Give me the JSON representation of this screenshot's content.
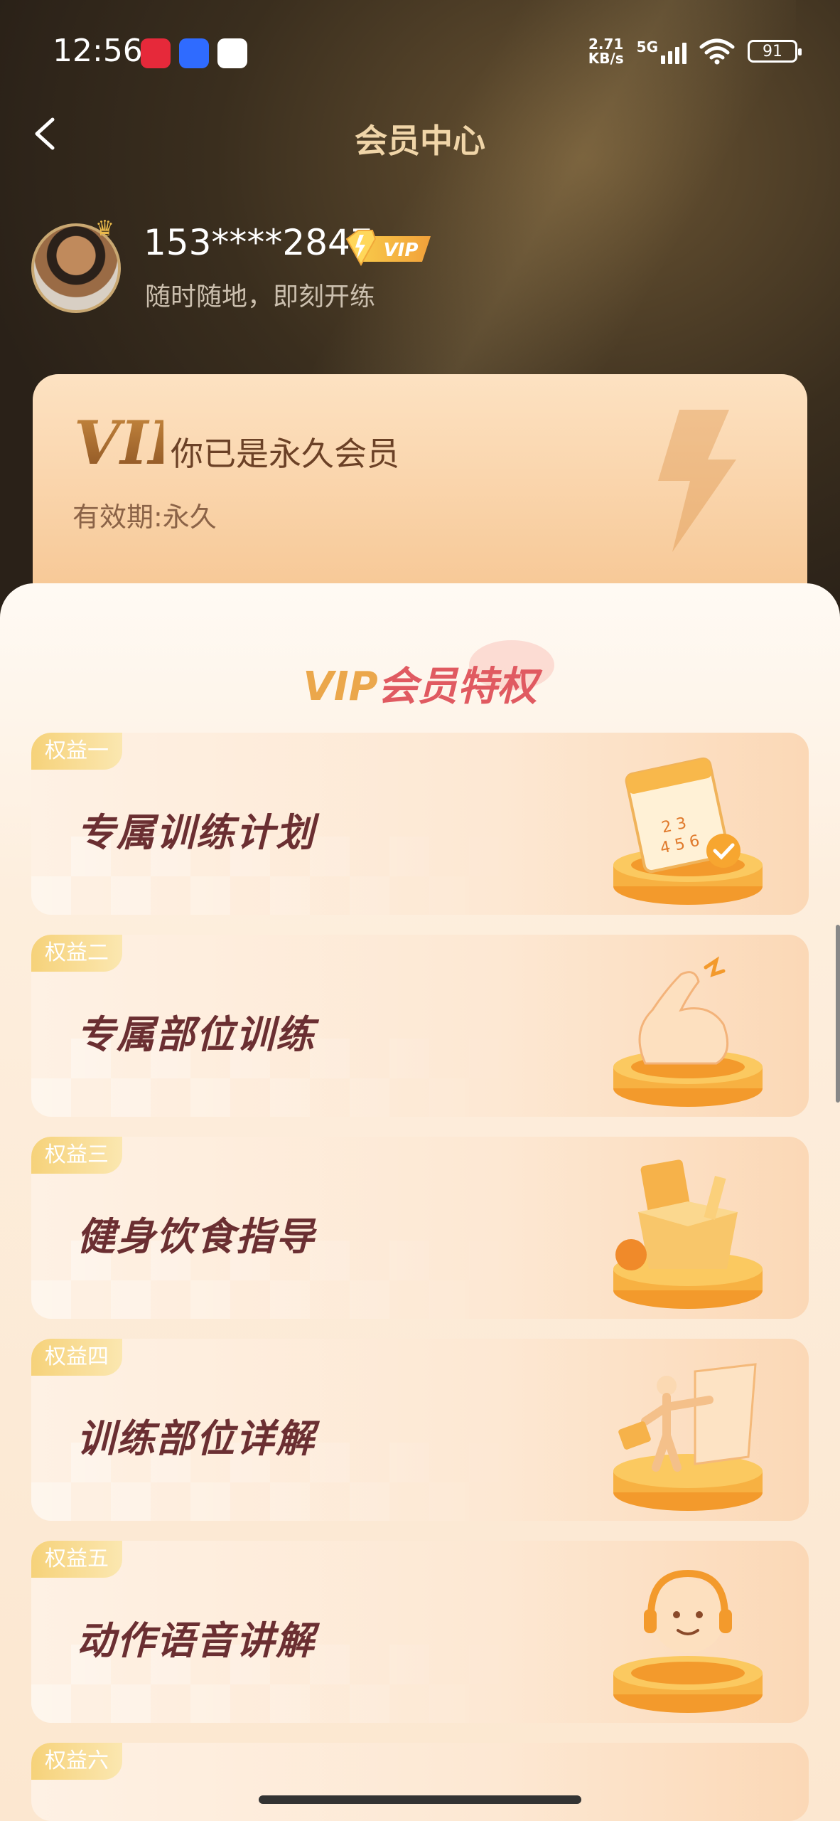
{
  "status_bar": {
    "time": "12:56",
    "net_speed_value": "2.71",
    "net_speed_unit": "KB/s",
    "network": "5G",
    "battery": "91",
    "app_icons": [
      "xiaohongshu-icon",
      "blue-chat-icon",
      "browser-icon"
    ]
  },
  "nav": {
    "title": "会员中心"
  },
  "profile": {
    "phone": "153****2847",
    "badge": "VIP",
    "slogan": "随时随地，即刻开练"
  },
  "vip_card": {
    "logo": "VIP",
    "title": "你已是永久会员",
    "expire": "有效期:永久"
  },
  "privileges": {
    "title_vip": "VIP",
    "title_rest": "会员特权",
    "items": [
      {
        "tag": "权益一",
        "name": "专属训练计划",
        "icon": "calendar-icon"
      },
      {
        "tag": "权益二",
        "name": "专属部位训练",
        "icon": "muscle-arm-icon"
      },
      {
        "tag": "权益三",
        "name": "健身饮食指导",
        "icon": "food-box-icon"
      },
      {
        "tag": "权益四",
        "name": "训练部位详解",
        "icon": "body-detail-icon"
      },
      {
        "tag": "权益五",
        "name": "动作语音讲解",
        "icon": "headset-voice-icon"
      },
      {
        "tag": "权益六",
        "name": "",
        "icon": "more-icon"
      }
    ]
  },
  "colors": {
    "header_dark": "#2a2118",
    "gold_text": "#f0d5a8",
    "benefit_name": "#6b2f32",
    "vip_orange": "#eba74b",
    "vip_red": "#e05a61"
  }
}
